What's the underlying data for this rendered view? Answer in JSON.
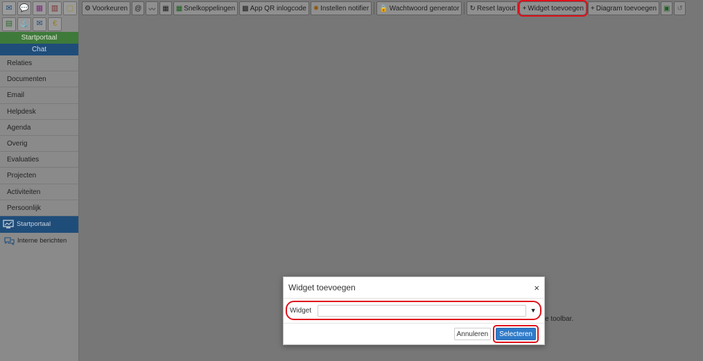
{
  "sidebar": {
    "app_icons": [
      {
        "name": "mail-icon",
        "glyph": "✉",
        "color": "#1f4d7a"
      },
      {
        "name": "chat-icon",
        "glyph": "💬",
        "color": "#2d7a2d"
      },
      {
        "name": "calendar-icon",
        "glyph": "▦",
        "color": "#7a2d7a"
      },
      {
        "name": "building-icon",
        "glyph": "▥",
        "color": "#7a2d2d"
      },
      {
        "name": "note-icon",
        "glyph": "▢",
        "color": "#9a8a2d"
      },
      {
        "name": "spreadsheet-icon",
        "glyph": "▤",
        "color": "#2d6a2d"
      },
      {
        "name": "anchor-icon",
        "glyph": "⚓",
        "color": "#1f4d7a"
      },
      {
        "name": "envelope-icon",
        "glyph": "✉",
        "color": "#1f4d7a"
      },
      {
        "name": "euro-icon",
        "glyph": "€",
        "color": "#9a7a1a"
      }
    ],
    "startportaal_pill": "Startportaal",
    "chat_pill": "Chat",
    "nav_items": [
      "Relaties",
      "Documenten",
      "Email",
      "Helpdesk",
      "Agenda",
      "Overig",
      "Evaluaties",
      "Projecten",
      "Activiteiten",
      "Persoonlijk"
    ],
    "active_item": "Startportaal",
    "messages_item": "Interne berichten"
  },
  "toolbar": {
    "voorkeuren": "Voorkeuren",
    "snelkoppelingen": "Snelkoppelingen",
    "app_qr": "App QR inlogcode",
    "notifier": "Instellen notifier",
    "wachtwoord": "Wachtwoord generator",
    "reset_layout": "Reset layout",
    "widget_toevoegen": "Widget toevoegen",
    "diagram_toevoegen": "Diagram toevoegen"
  },
  "modal": {
    "title": "Widget toevoegen",
    "close": "×",
    "field_label": "Widget",
    "select_value": "",
    "cancel": "Annuleren",
    "confirm": "Selecteren"
  },
  "background_note": "e toolbar."
}
